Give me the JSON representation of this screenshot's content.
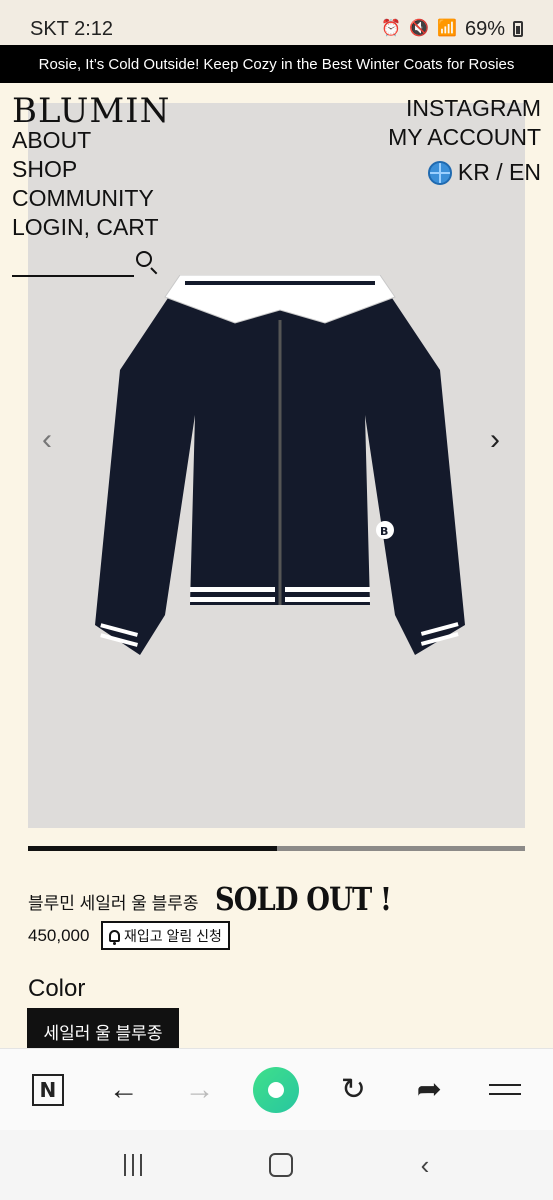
{
  "status": {
    "carrier_time": "SKT 2:12",
    "battery": "69%",
    "icons": [
      "alarm-icon",
      "mute-icon",
      "wifi-icon",
      "signal-icon",
      "battery-icon"
    ]
  },
  "promo": {
    "text": "Rosie, It’s Cold Outside! Keep Cozy in the Best Winter Coats for Rosies"
  },
  "header": {
    "logo": "BLUMIN",
    "nav_left": [
      "ABOUT",
      "SHOP",
      "COMMUNITY",
      "LOGIN, CART"
    ],
    "nav_right": [
      "INSTAGRAM",
      "MY ACCOUNT"
    ],
    "lang": "KR / EN"
  },
  "gallery": {
    "progress_fraction": 0.5
  },
  "product": {
    "name": "블루민 세일러 울 블루종",
    "sold_out": "SOLD OUT !",
    "price": "450,000",
    "restock_label": "재입고 알림 신청",
    "color_label": "Color",
    "color_option": "세일러 울 블루종"
  },
  "browser": {
    "icons": [
      "naver-icon",
      "back-arrow-icon",
      "forward-arrow-icon",
      "green-dot-button",
      "reload-icon",
      "share-icon",
      "menu-icon"
    ]
  },
  "colors": {
    "accent_black": "#111111",
    "page_bg": "#fbf5e6",
    "hero_bg": "#dedcda",
    "green": "#3fe08a"
  }
}
